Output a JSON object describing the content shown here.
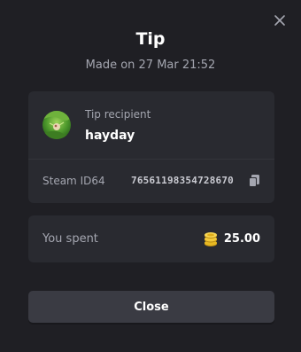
{
  "colors": {
    "background": "#1f1f24",
    "card": "#292a30",
    "button": "#3a3b43",
    "muted_text": "#a4a6b0",
    "coin_gold": "#e8b923"
  },
  "header": {
    "title": "Tip",
    "subtitle": "Made on 27 Mar 21:52",
    "close_icon": "close-icon"
  },
  "recipient": {
    "label": "Tip recipient",
    "name": "hayday",
    "avatar_icon": "avatar",
    "steam_label": "Steam ID64",
    "steam_id": "76561198354728670",
    "copy_icon": "copy-icon"
  },
  "spent": {
    "label": "You spent",
    "amount": "25.00",
    "coin_icon": "coins-icon"
  },
  "footer": {
    "close_label": "Close"
  }
}
